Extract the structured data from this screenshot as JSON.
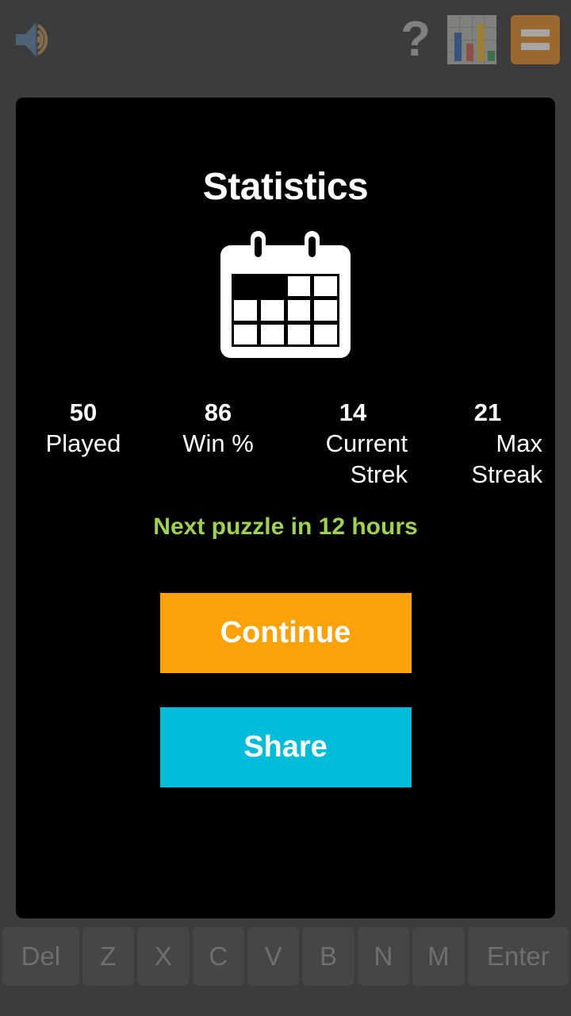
{
  "topbar": {
    "speaker_icon": "speaker-volume-icon",
    "help_icon": "question-mark-help-icon",
    "help_glyph": "?",
    "chart_icon": "bar-chart-statistics-icon",
    "menu_icon": "hamburger-menu-icon",
    "background_color": "#3c3c3c"
  },
  "dialog": {
    "title": "Statistics",
    "calendar_icon": "calendar-icon",
    "background_color": "#000000",
    "stats": [
      {
        "value": "50",
        "label": "Played"
      },
      {
        "value": "86",
        "label": "Win %"
      },
      {
        "value": "14",
        "label": "Current Strek"
      },
      {
        "value": "21",
        "label": "Max Streak"
      }
    ],
    "countdown": "Next puzzle in 12 hours",
    "countdown_color": "#9ed155",
    "buttons": [
      {
        "label": "Continue",
        "color": "#faa207"
      },
      {
        "label": "Share",
        "color": "#00bcd8"
      }
    ]
  },
  "keyboard": {
    "keys": [
      "Del",
      "Z",
      "X",
      "C",
      "V",
      "B",
      "N",
      "M",
      "Enter"
    ],
    "key_color": "#464646",
    "key_text_color": "#6f6f6f"
  }
}
